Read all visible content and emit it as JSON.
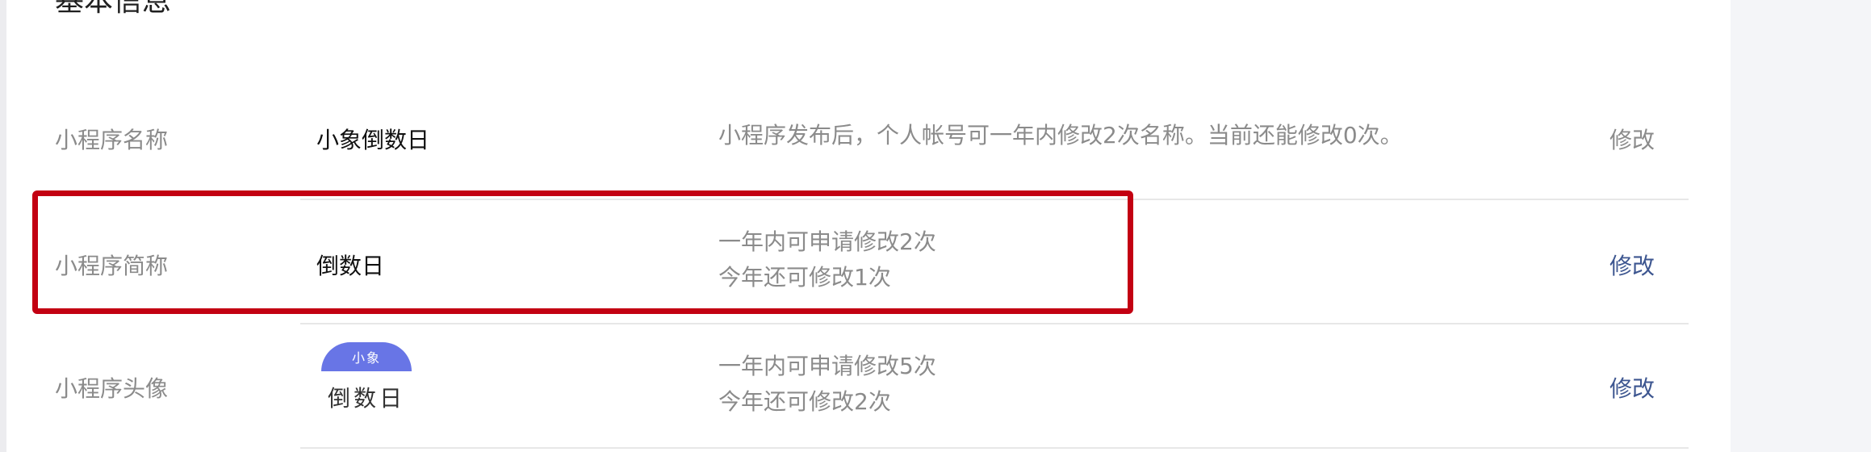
{
  "section": {
    "title": "基本信息"
  },
  "rows": [
    {
      "label": "小程序名称",
      "value": "小象倒数日",
      "desc_lines": [
        "小程序发布后，个人帐号可一年内修改2次名称。当前还能修改0次。"
      ],
      "action": "修改",
      "action_state": "disabled"
    },
    {
      "label": "小程序简称",
      "value": "倒数日",
      "desc_lines": [
        "一年内可申请修改2次",
        "今年还可修改1次"
      ],
      "action": "修改",
      "action_state": "enabled",
      "highlighted": true
    },
    {
      "label": "小程序头像",
      "avatar": {
        "top_text": "小象",
        "bottom_text": "倒数日"
      },
      "desc_lines": [
        "一年内可申请修改5次",
        "今年还可修改2次"
      ],
      "action": "修改",
      "action_state": "enabled"
    }
  ],
  "colors": {
    "highlight_border": "#c30012",
    "link": "#3d5690",
    "muted": "#8b8b8b",
    "avatar_blue": "#6875e6"
  }
}
